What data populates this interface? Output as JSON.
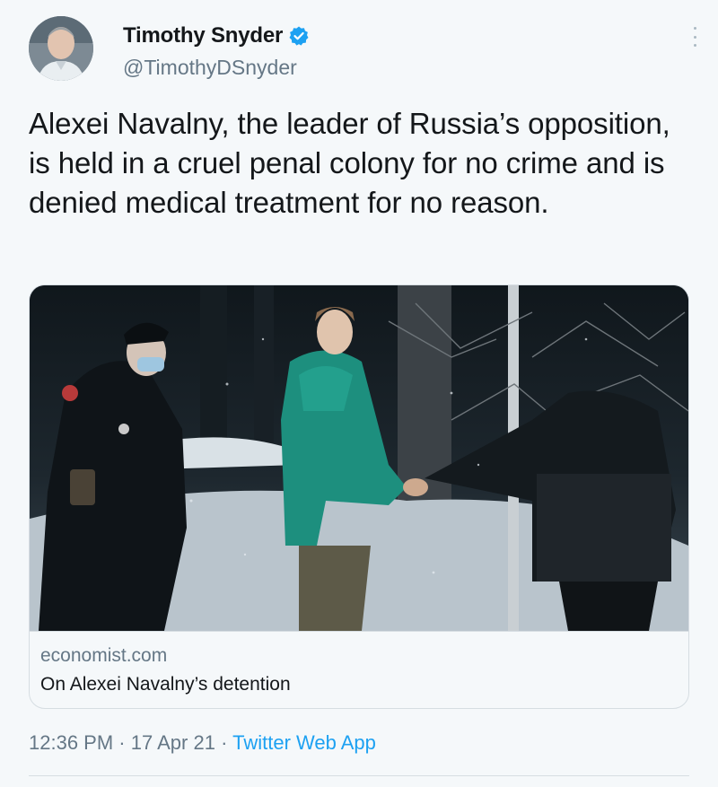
{
  "author": {
    "display_name": "Timothy Snyder",
    "handle": "@TimothyDSnyder",
    "verified": true
  },
  "icons": {
    "verified": "verified-badge-icon",
    "more": "more-vertical-icon"
  },
  "tweet": {
    "text": "Alexei Navalny, the leader of Russia’s opposition, is held in a cruel penal colony for no crime and is denied medical treatment for no reason."
  },
  "card": {
    "domain": "economist.com",
    "title": "On Alexei Navalny’s detention"
  },
  "meta": {
    "time": "12:36 PM",
    "separator": "·",
    "date": "17 Apr 21",
    "source": "Twitter Web App"
  },
  "colors": {
    "accent": "#1da1f2",
    "text": "#14171a",
    "muted": "#657786",
    "background": "#f5f8fa"
  }
}
